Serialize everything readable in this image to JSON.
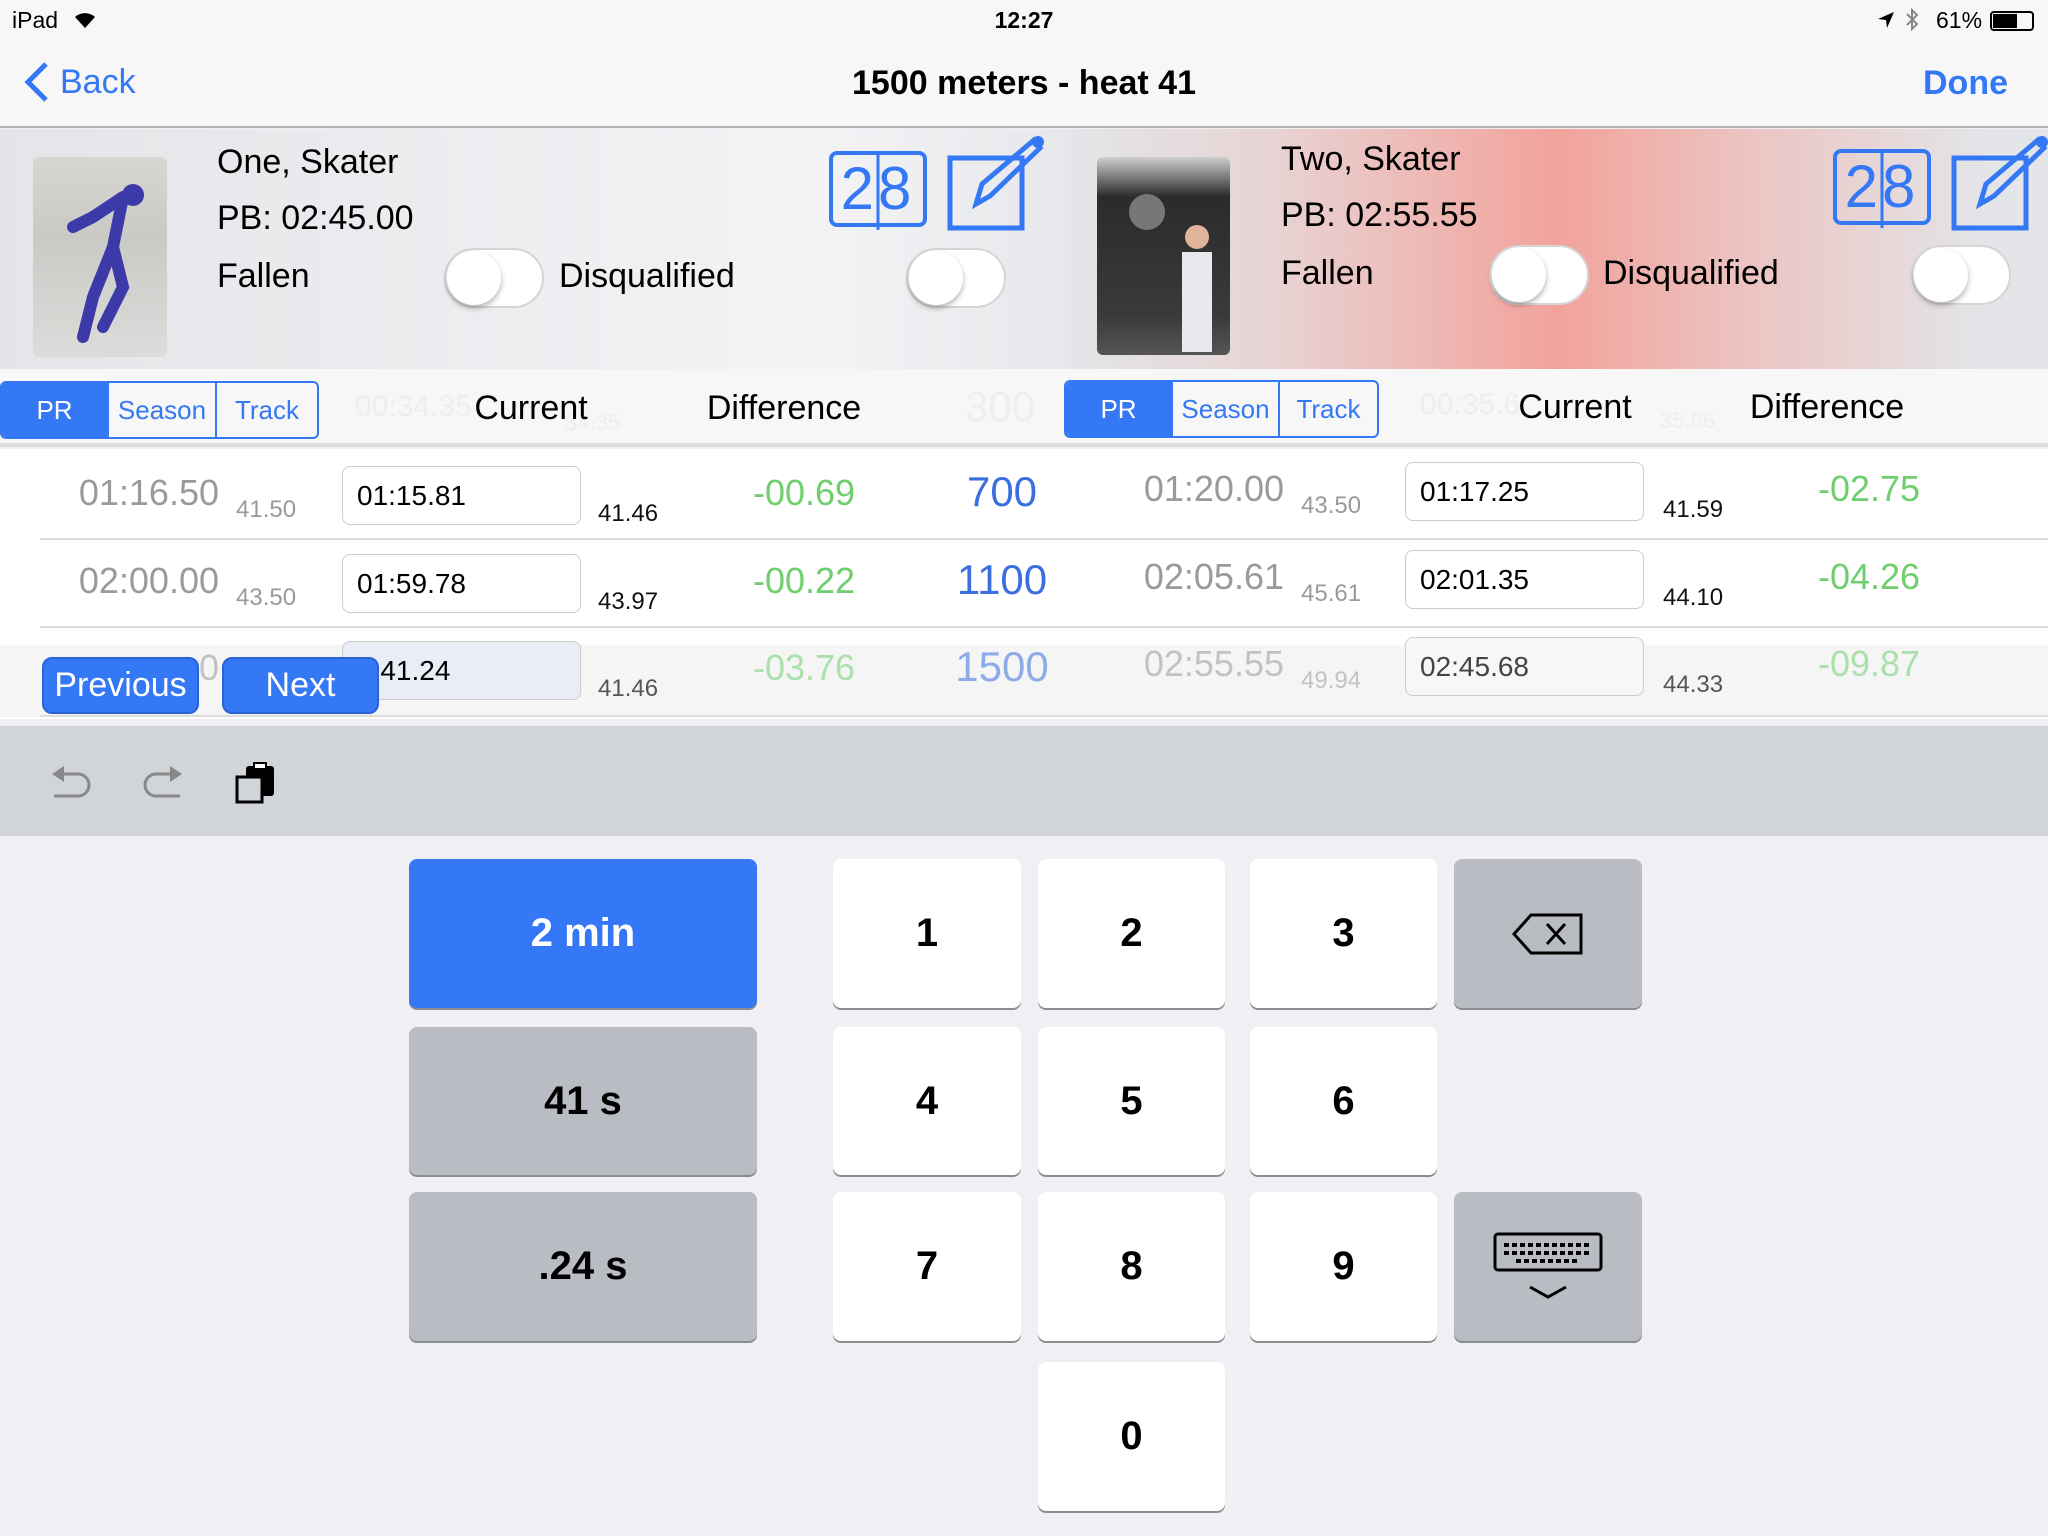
{
  "status_bar": {
    "device": "iPad",
    "time": "12:27",
    "battery": "61%",
    "icons": [
      "wifi-icon",
      "location-icon",
      "bluetooth-icon",
      "battery-icon"
    ]
  },
  "nav": {
    "back_label": "Back",
    "title": "1500 meters - heat 41",
    "done_label": "Done"
  },
  "skaters": [
    {
      "name": "One, Skater",
      "pb": "PB: 02:45.00",
      "fallen_label": "Fallen",
      "disqualified_label": "Disqualified",
      "fallen_on": false,
      "disqualified_on": false,
      "calendar_number": "28",
      "segments": [
        "PR",
        "Season",
        "Track"
      ],
      "selected_segment": "PR",
      "current_header": "Current",
      "difference_header": "Difference",
      "ghost_row": {
        "ref": "00:34.35",
        "lap": "34.35",
        "distance": "300"
      },
      "rows": [
        {
          "ref": "01:16.50",
          "ref_lap": "41.50",
          "current": "01:15.81",
          "lap": "41.46",
          "diff": "-00.69",
          "distance": "700"
        },
        {
          "ref": "02:00.00",
          "ref_lap": "43.50",
          "current": "01:59.78",
          "lap": "43.97",
          "diff": "-00.22",
          "distance": "1100"
        },
        {
          "ref": "0",
          "ref_lap": "",
          "current": "2:41.24",
          "lap": "41.46",
          "diff": "-03.76",
          "distance": "1500"
        }
      ]
    },
    {
      "name": "Two, Skater",
      "pb": "PB: 02:55.55",
      "fallen_label": "Fallen",
      "disqualified_label": "Disqualified",
      "fallen_on": false,
      "disqualified_on": false,
      "calendar_number": "28",
      "segments": [
        "PR",
        "Season",
        "Track"
      ],
      "selected_segment": "PR",
      "current_header": "Current",
      "difference_header": "Difference",
      "ghost_row": {
        "ref": "00:35.6",
        "lap": "35.66"
      },
      "rows": [
        {
          "ref": "01:20.00",
          "ref_lap": "43.50",
          "current": "01:17.25",
          "lap": "41.59",
          "diff": "-02.75"
        },
        {
          "ref": "02:05.61",
          "ref_lap": "45.61",
          "current": "02:01.35",
          "lap": "44.10",
          "diff": "-04.26"
        },
        {
          "ref": "02:55.55",
          "ref_lap": "49.94",
          "current": "02:45.68",
          "lap": "44.33",
          "diff": "-09.87"
        }
      ]
    }
  ],
  "input_nav": {
    "previous_label": "Previous",
    "next_label": "Next"
  },
  "toolbar": {
    "icons": [
      "undo-icon",
      "redo-icon",
      "paste-icon"
    ]
  },
  "keypad": {
    "suggestions": [
      "2 min",
      "41 s",
      ".24 s"
    ],
    "digits": [
      "1",
      "2",
      "3",
      "4",
      "5",
      "6",
      "7",
      "8",
      "9",
      "0"
    ],
    "accent": "#3478f6"
  }
}
